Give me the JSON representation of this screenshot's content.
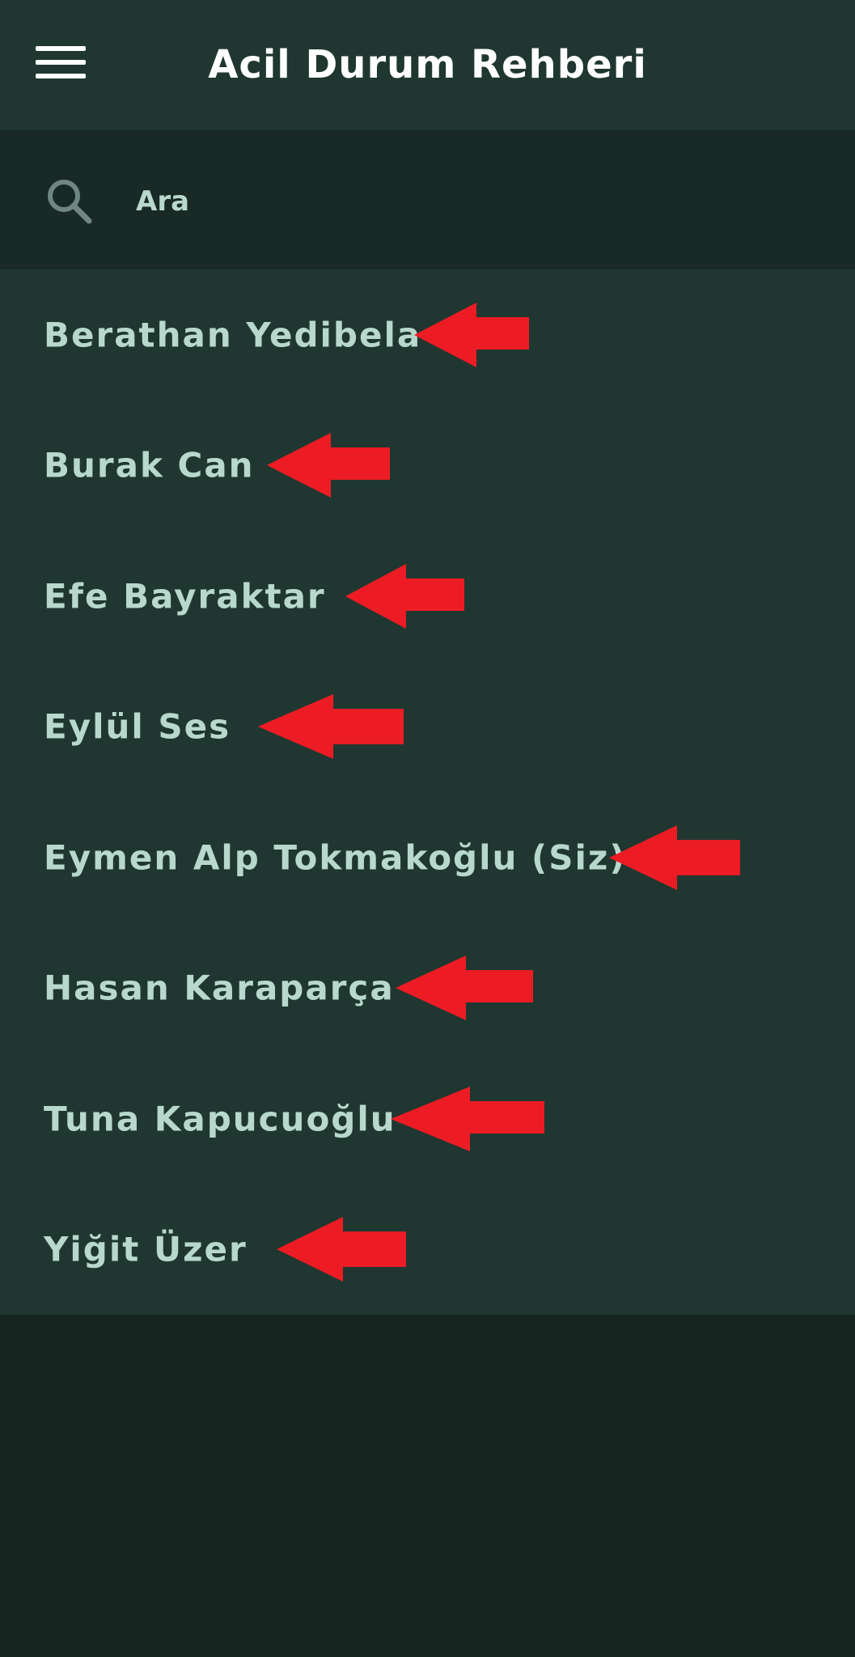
{
  "header": {
    "title": "Acil Durum Rehberi",
    "menu_icon": "hamburger-menu-icon"
  },
  "search": {
    "placeholder": "Ara",
    "value": "",
    "icon": "search-icon"
  },
  "contacts": [
    {
      "name": "Berathan Yedibela"
    },
    {
      "name": "Burak Can"
    },
    {
      "name": "Efe Bayraktar"
    },
    {
      "name": "Eylül Ses"
    },
    {
      "name": "Eymen Alp Tokmakoğlu (Siz)"
    },
    {
      "name": "Hasan Karaparça"
    },
    {
      "name": "Tuna Kapucuoğlu"
    },
    {
      "name": "Yiğit Üzer"
    }
  ],
  "annotation": {
    "icon": "red-arrow-left-icon",
    "color": "#ed1c24"
  },
  "colors": {
    "header_bg": "#1f3730",
    "search_bg": "#192925",
    "list_bg": "#1f3730",
    "page_bg": "#162520",
    "text": "#b8d8cc"
  }
}
